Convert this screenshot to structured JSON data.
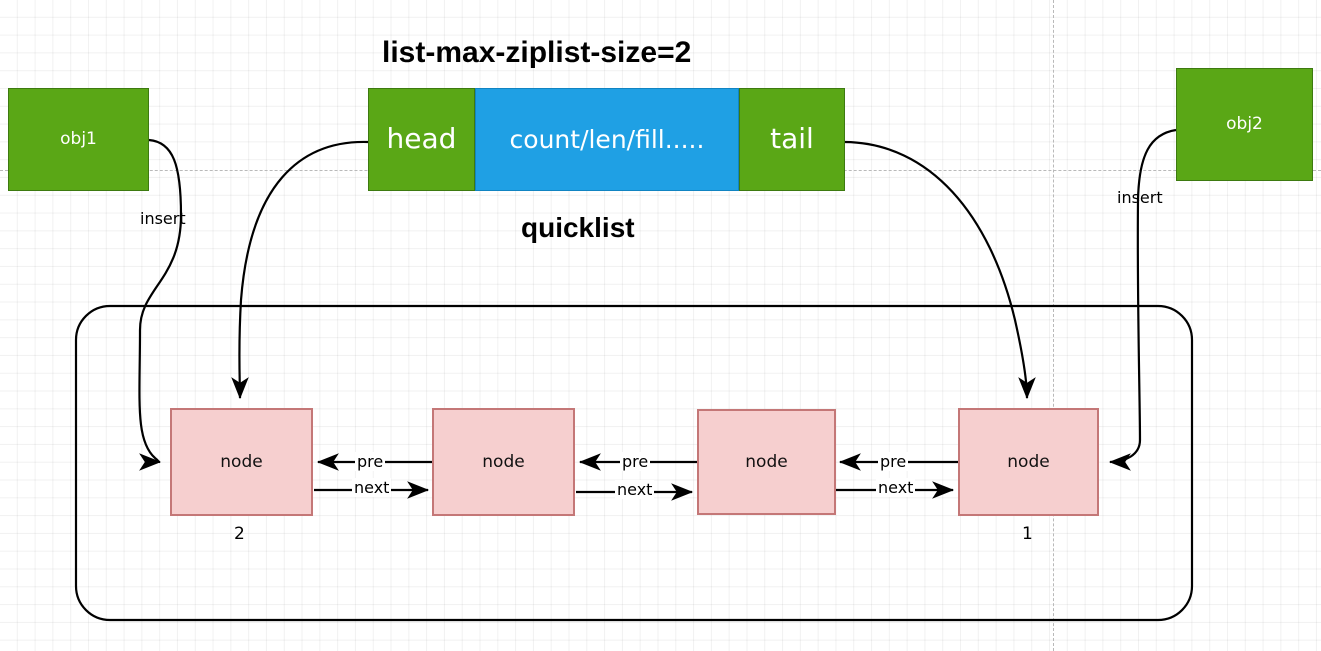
{
  "diagram": {
    "title": "list-max-ziplist-size=2",
    "caption": "quicklist",
    "quicklist": {
      "head_label": "head",
      "body_label": "count/len/fill.....",
      "tail_label": "tail"
    },
    "objects": [
      {
        "name": "obj1",
        "label": "obj1",
        "insert_label": "insert"
      },
      {
        "name": "obj2",
        "label": "obj2",
        "insert_label": "insert"
      }
    ],
    "nodes": [
      {
        "label": "node",
        "index_label": "2"
      },
      {
        "label": "node",
        "index_label": ""
      },
      {
        "label": "node",
        "index_label": ""
      },
      {
        "label": "node",
        "index_label": "1"
      }
    ],
    "link_labels": {
      "prev": "pre",
      "next": "next"
    },
    "links": [
      {
        "prev": "pre",
        "next": "next"
      },
      {
        "prev": "pre",
        "next": "next"
      },
      {
        "prev": "pre",
        "next": "next"
      }
    ],
    "colors": {
      "object_fill": "#5AA716",
      "object_stroke": "#3d7a10",
      "quicklist_body_fill": "#1FA0E4",
      "quicklist_body_stroke": "#1184c2",
      "node_fill": "#F6CFCF",
      "node_stroke": "#C47777",
      "edge": "#000000",
      "grid": "#e8e8e8",
      "grid_major": "#b9b9b9",
      "background": "#ffffff"
    }
  }
}
